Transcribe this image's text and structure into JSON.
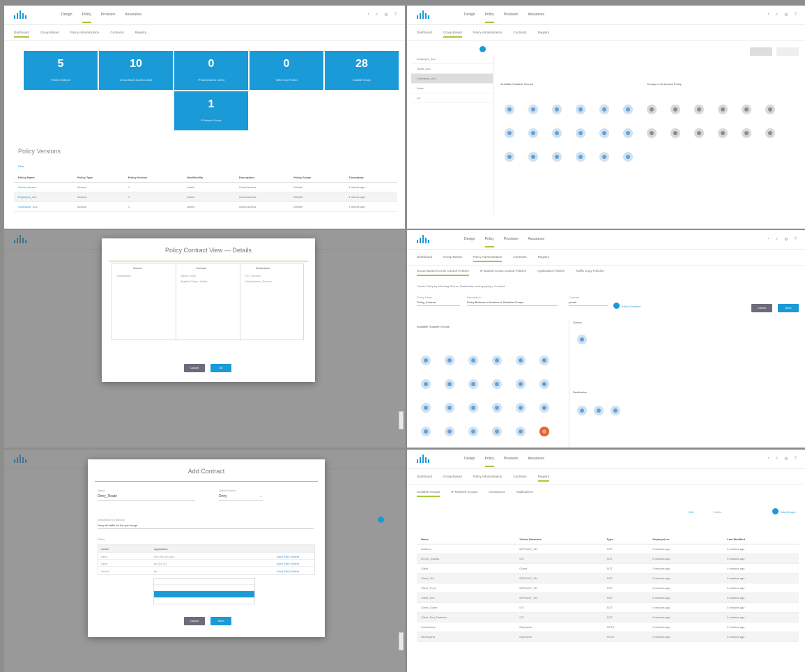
{
  "panel1": {
    "nav": [
      "Design",
      "Policy",
      "Provision",
      "Assurance"
    ],
    "subtabs": [
      "Dashboard",
      "Group-Based",
      "Policy Administration",
      "Contracts",
      "Registry"
    ],
    "tiles": [
      {
        "value": "5",
        "label": "Policies Deployed"
      },
      {
        "value": "10",
        "label": "Groups Based Access Control"
      },
      {
        "value": "0",
        "label": "IP Based Access Control"
      },
      {
        "value": "0",
        "label": "Traffic Copy Policies"
      },
      {
        "value": "28",
        "label": "Scalable Groups"
      },
      {
        "value": "1",
        "label": "IP Network Groups"
      }
    ],
    "section_title": "Policy Versions",
    "filter_label": "Filter",
    "columns": [
      "Policy Name",
      "Policy Type",
      "Policy Version",
      "Modified By",
      "Description",
      "Policy Scope",
      "Timestamp"
    ],
    "rows": [
      [
        "Guest_Access",
        "Access",
        "1",
        "admin",
        "Guest Access",
        "Default",
        "1 minute ago"
      ],
      [
        "Employee_Acc",
        "Access",
        "1",
        "admin",
        "Guest Access",
        "Default",
        "1 minute ago"
      ],
      [
        "Contractor_Acc",
        "Access",
        "1",
        "admin",
        "Guest Access",
        "Default",
        "1 minute ago"
      ]
    ]
  },
  "panel2": {
    "groups": [
      "Employee_Acc",
      "Guest_Acc",
      "Contractor_Acc",
      "Voice",
      "IoT"
    ],
    "left_title": "Available Scalable Groups",
    "right_title": "Groups in the Access Policy"
  },
  "panel3": {
    "modal_title": "Policy Contract View — Details",
    "col_headers": [
      "Source",
      "Contract",
      "Destination"
    ],
    "source_val": "Contractors",
    "contract_lines": [
      "Name: Deny",
      "Applied Group: Inside"
    ],
    "dest_lines": [
      "PCI_Servers",
      "Development_Servers"
    ],
    "cancel_label": "Cancel",
    "ok_label": "OK"
  },
  "panel4": {
    "subtabs": [
      "Group-Based Access Control Policies",
      "IP Based Access Control Policies",
      "Application Policies",
      "Traffic Copy Policies"
    ],
    "instruction": "Create Policy by selecting Source, Destination, and applying a Contract",
    "policy_name_label": "Policy Name",
    "policy_name": "Policy_Contract",
    "desc_label": "Description",
    "desc": "Policy Between a Number of Scalable Groups",
    "contract_label": "Contract",
    "contract_val": "permit",
    "add_contract": "Add a Contract",
    "cancel_label": "Cancel",
    "save_label": "Save",
    "available_title": "Available Scalable Groups",
    "source_title": "Source",
    "dest_title": "Destination"
  },
  "panel5": {
    "modal_title": "Add Contract",
    "name_label": "Name",
    "name_val": "Deny_Route",
    "default_label": "Default Action",
    "default_val": "Deny",
    "desc_label": "Description (Optional)",
    "desc_val": "Deny all traffic for the port range",
    "rules_label": "Rules",
    "rule_cols": [
      "Action",
      "Application"
    ],
    "rules": [
      [
        "Deny",
        "dns (53,tcp,udp)"
      ],
      [
        "Deny",
        "ftp (20,21)"
      ],
      [
        "Permit",
        "ftp"
      ]
    ],
    "rule_actions": "Add | Edit | Delete",
    "cancel_label": "Cancel",
    "save_label": "Save"
  },
  "panel6": {
    "subtabs": [
      "Scalable Groups",
      "IP Network Groups",
      "Contractors",
      "Applications"
    ],
    "toolbar": [
      "Edit",
      "Delete"
    ],
    "add_label": "Add Groups",
    "columns": [
      "Name",
      "Virtual Networks",
      "Type",
      "Deployed on",
      "Last Modified"
    ],
    "rows": [
      [
        "Auditors",
        "DEFAULT_VN",
        "SGT",
        "5 minutes ago",
        "5 minutes ago"
      ],
      [
        "BYOD_Guests",
        "IOT",
        "SGT",
        "5 minutes ago",
        "5 minutes ago"
      ],
      [
        "Client",
        "Guest",
        "SGT",
        "5 minutes ago",
        "5 minutes ago"
      ],
      [
        "Client_VN",
        "DEFAULT_VN",
        "SGT",
        "5 minutes ago",
        "5 minutes ago"
      ],
      [
        "Client_Prod",
        "DEFAULT_VN",
        "SGT",
        "5 minutes ago",
        "5 minutes ago"
      ],
      [
        "Client_Dev",
        "DEFAULT_VN",
        "SGT",
        "5 minutes ago",
        "5 minutes ago"
      ],
      [
        "Client_Guest",
        "IOT",
        "SGT",
        "5 minutes ago",
        "5 minutes ago"
      ],
      [
        "Client_Test_Partners",
        "IOT",
        "SGT",
        "5 minutes ago",
        "5 minutes ago"
      ],
      [
        "Contractors",
        "Employee",
        "SGTS",
        "5 minutes ago",
        "5 minutes ago"
      ],
      [
        "Developers",
        "Employee",
        "SGTS",
        "5 minutes ago",
        "5 minutes ago"
      ]
    ]
  },
  "icons": [
    "bell-icon",
    "search-icon",
    "gear-icon",
    "help-icon"
  ]
}
